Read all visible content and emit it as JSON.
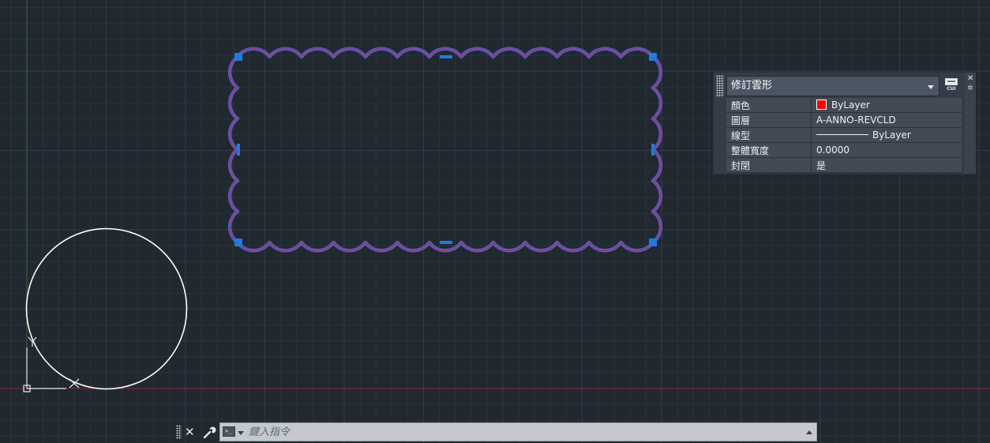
{
  "colors": {
    "background": "#212830",
    "grid_minor": "#2a323c",
    "grid_major": "#323b47",
    "x_axis": "#8a2a35",
    "y_axis": "#2f6e33",
    "revcloud_outer": "#4a64b8",
    "revcloud_inner": "#a2327e",
    "grip": "#1e7be0",
    "circle": "#ffffff",
    "color_swatch": "#ff0000"
  },
  "drawing": {
    "revcloud_label": "revision-cloud",
    "circle_label": "circle",
    "ucs_label": "ucs-icon"
  },
  "quick_properties": {
    "object_type": "修訂雲形",
    "cui_label": "CUI",
    "close_glyph": "✕",
    "settings_glyph": "✲",
    "rows": [
      {
        "key": "顏色",
        "value": "ByLayer",
        "icon": "color-swatch"
      },
      {
        "key": "圖層",
        "value": "A-ANNO-REVCLD"
      },
      {
        "key": "線型",
        "value": "ByLayer",
        "icon": "linetype-sample"
      },
      {
        "key": "整體寬度",
        "value": "0.0000"
      },
      {
        "key": "封閉",
        "value": "是"
      }
    ]
  },
  "command_line": {
    "close_glyph": "✕",
    "prompt_glyph": ">_",
    "placeholder": "鍵入指令"
  }
}
